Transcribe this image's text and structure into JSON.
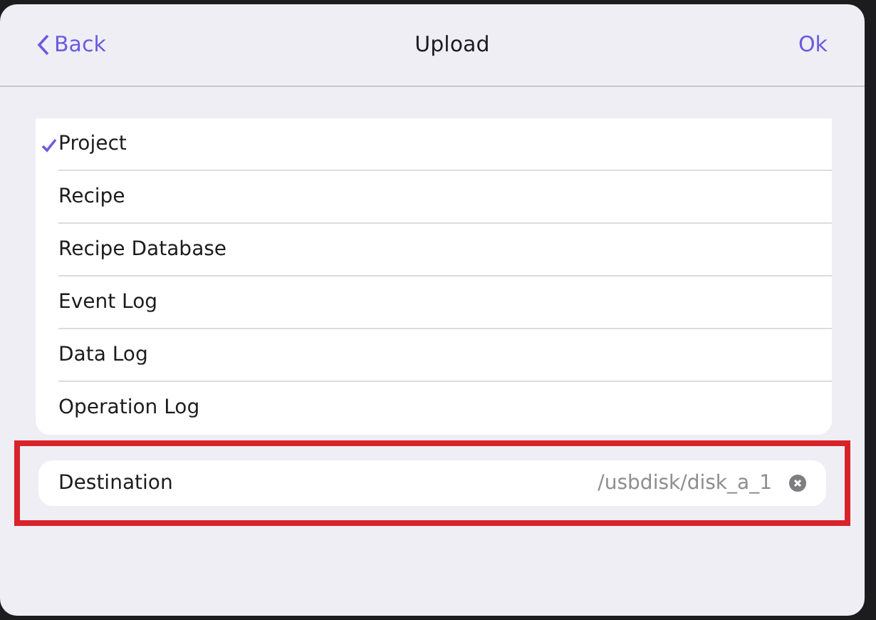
{
  "header": {
    "back": "Back",
    "title": "Upload",
    "ok": "Ok"
  },
  "items": [
    {
      "label": "Project",
      "selected": true
    },
    {
      "label": "Recipe",
      "selected": false
    },
    {
      "label": "Recipe Database",
      "selected": false
    },
    {
      "label": "Event Log",
      "selected": false
    },
    {
      "label": "Data Log",
      "selected": false
    },
    {
      "label": "Operation Log",
      "selected": false
    }
  ],
  "destination": {
    "label": "Destination",
    "value": "/usbdisk/disk_a_1",
    "highlighted": true
  }
}
